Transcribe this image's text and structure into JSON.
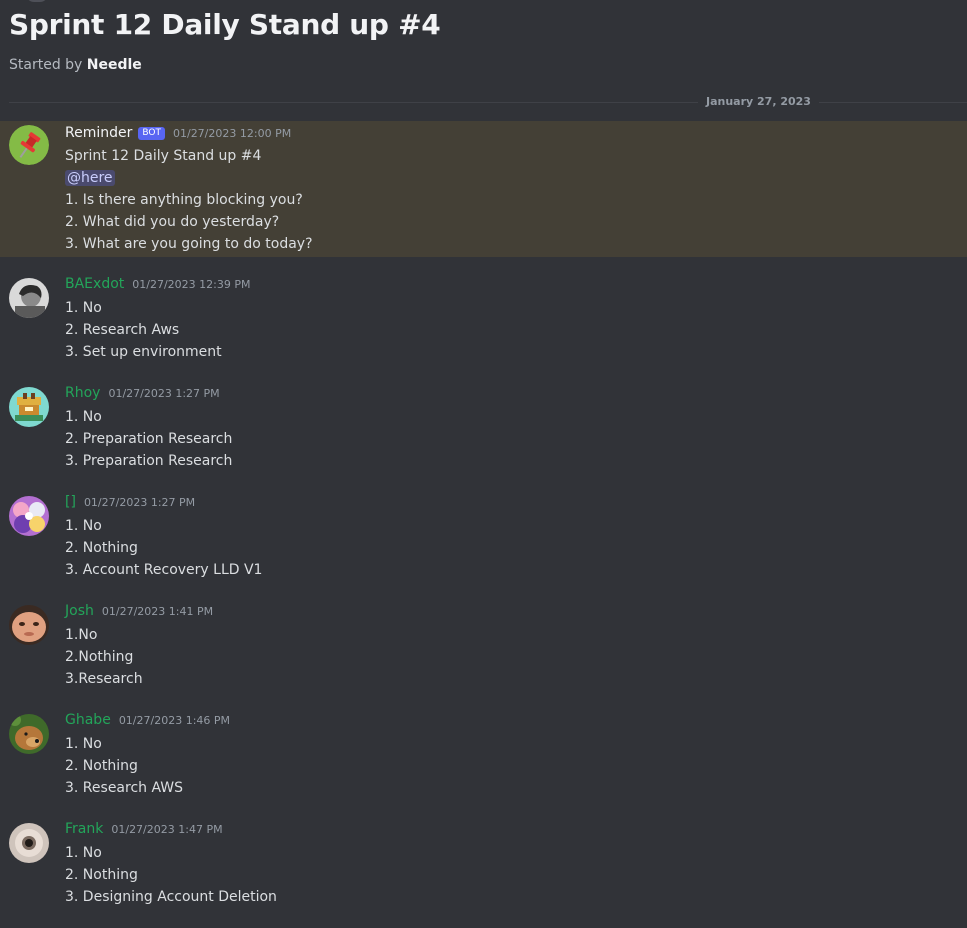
{
  "thread": {
    "title": "Sprint 12 Daily Stand up #4",
    "started_prefix": "Started by",
    "started_by": "Needle"
  },
  "divider": {
    "date": "January 27, 2023"
  },
  "bot_message": {
    "author": "Reminder",
    "tag": "BOT",
    "timestamp": "01/27/2023 12:00 PM",
    "lines": [
      "Sprint 12 Daily Stand up #4",
      "@here",
      "1. Is there anything blocking you?",
      "2. What did you do yesterday?",
      "3. What are you going to do today?"
    ],
    "colors": {
      "highlight": "#444036",
      "avatar_bg": "#7cb342",
      "pin": "#e53935"
    },
    "avatar_icon": "pushpin-icon"
  },
  "messages": [
    {
      "author": "BAExdot",
      "timestamp": "01/27/2023 12:39 PM",
      "lines": [
        "1. No",
        "2. Research Aws",
        "3. Set up environment"
      ],
      "avatar_icon": "person-photo-icon"
    },
    {
      "author": "Rhoy",
      "timestamp": "01/27/2023 1:27 PM",
      "lines": [
        "1. No",
        "2. Preparation Research",
        "3. Preparation Research"
      ],
      "avatar_icon": "pixel-art-icon"
    },
    {
      "author": "[]",
      "timestamp": "01/27/2023 1:27 PM",
      "lines": [
        "1. No",
        "2. Nothing",
        "3. Account Recovery LLD V1"
      ],
      "avatar_icon": "anime-art-icon"
    },
    {
      "author": "Josh",
      "timestamp": "01/27/2023 1:41 PM",
      "lines": [
        "1.No",
        "2.Nothing",
        "3.Research"
      ],
      "avatar_icon": "face-photo-icon"
    },
    {
      "author": "Ghabe",
      "timestamp": "01/27/2023 1:46 PM",
      "lines": [
        "1. No",
        "2. Nothing",
        "3. Research AWS"
      ],
      "avatar_icon": "dog-photo-icon"
    },
    {
      "author": "Frank",
      "timestamp": "01/27/2023 1:47 PM",
      "lines": [
        "1. No",
        "2. Nothing",
        "3. Designing Account Deletion"
      ],
      "avatar_icon": "eye-photo-icon"
    }
  ],
  "theme": {
    "background": "#313338",
    "member_name_color": "#23a55a",
    "bot_tag_color": "#5865f2"
  }
}
